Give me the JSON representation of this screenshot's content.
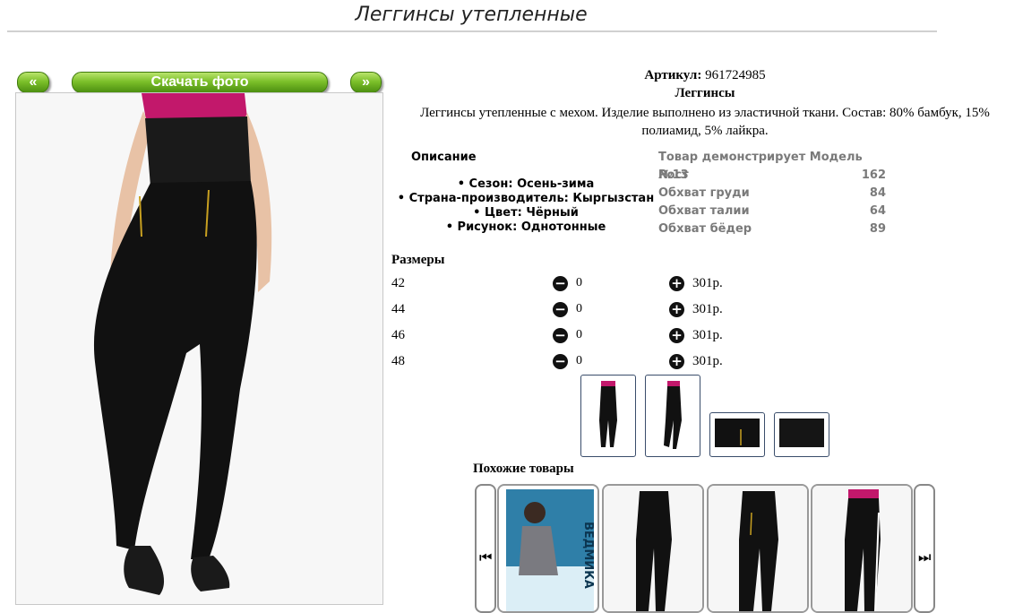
{
  "page": {
    "title": "Леггинсы утепленные"
  },
  "photo": {
    "prev_label": "«",
    "download_label": "Скачать фото",
    "next_label": "»"
  },
  "product": {
    "artikul_label": "Артикул:",
    "artikul_value": "961724985",
    "category": "Леггинсы",
    "description_line1": "Леггинсы утепленные с мехом. Изделие выполнено из эластичной ткани. Состав: 80% бамбук, 15%",
    "description_line2": "полиамид, 5% лайкра."
  },
  "details": {
    "heading": "Описание",
    "items": [
      "• Сезон: Осень-зима",
      "• Страна-производитель: Кыргызстан",
      "• Цвет: Чёрный",
      "• Рисунок: Однотонные"
    ]
  },
  "model": {
    "heading": "Товар демонстрирует Модель №13",
    "rows": [
      {
        "label": "Рост",
        "value": "162"
      },
      {
        "label": "Обхват груди",
        "value": "84"
      },
      {
        "label": "Обхват талии",
        "value": "64"
      },
      {
        "label": "Обхват бёдер",
        "value": "89"
      }
    ]
  },
  "sizes": {
    "heading": "Размеры",
    "rows": [
      {
        "size": "42",
        "qty": "0",
        "price": "301р."
      },
      {
        "size": "44",
        "qty": "0",
        "price": "301р."
      },
      {
        "size": "46",
        "qty": "0",
        "price": "301р."
      },
      {
        "size": "48",
        "qty": "0",
        "price": "301р."
      }
    ],
    "minus_icon": "minus-circle-icon",
    "plus_icon": "plus-circle-icon"
  },
  "similar": {
    "heading": "Похожие товары",
    "card_texts": [
      "ВЕДМИКА"
    ]
  },
  "colors": {
    "button_green": "#7cc02a",
    "thumb_border": "#3a4d6b",
    "legging_black": "#111111",
    "top_magenta": "#c2186b"
  }
}
